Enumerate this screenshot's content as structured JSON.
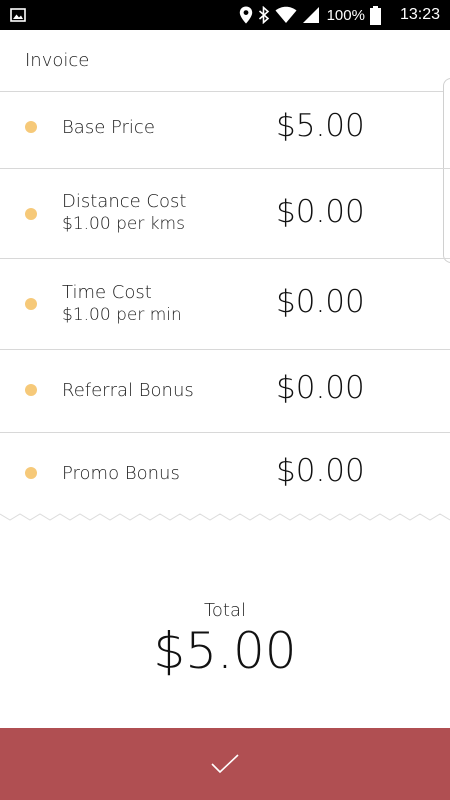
{
  "status_bar": {
    "battery": "100%",
    "time": "13:23",
    "icons": [
      "image-icon",
      "location-icon",
      "bluetooth-icon",
      "wifi-icon",
      "signal-icon",
      "battery-icon"
    ]
  },
  "header": {
    "title": "Invoice"
  },
  "items": [
    {
      "label": "Base Price",
      "sub": "",
      "amount": "$5.00"
    },
    {
      "label": "Distance Cost",
      "sub": "$1.00 per kms",
      "amount": "$0.00"
    },
    {
      "label": "Time Cost",
      "sub": "$1.00 per min",
      "amount": "$0.00"
    },
    {
      "label": "Referral Bonus",
      "sub": "",
      "amount": "$0.00"
    },
    {
      "label": "Promo Bonus",
      "sub": "",
      "amount": "$0.00"
    }
  ],
  "total": {
    "label": "Total",
    "amount": "$5.00"
  },
  "confirm": {
    "icon": "check-icon"
  },
  "colors": {
    "accent": "#b04f52",
    "dot": "#f6c979",
    "status_bar": "#000000"
  }
}
